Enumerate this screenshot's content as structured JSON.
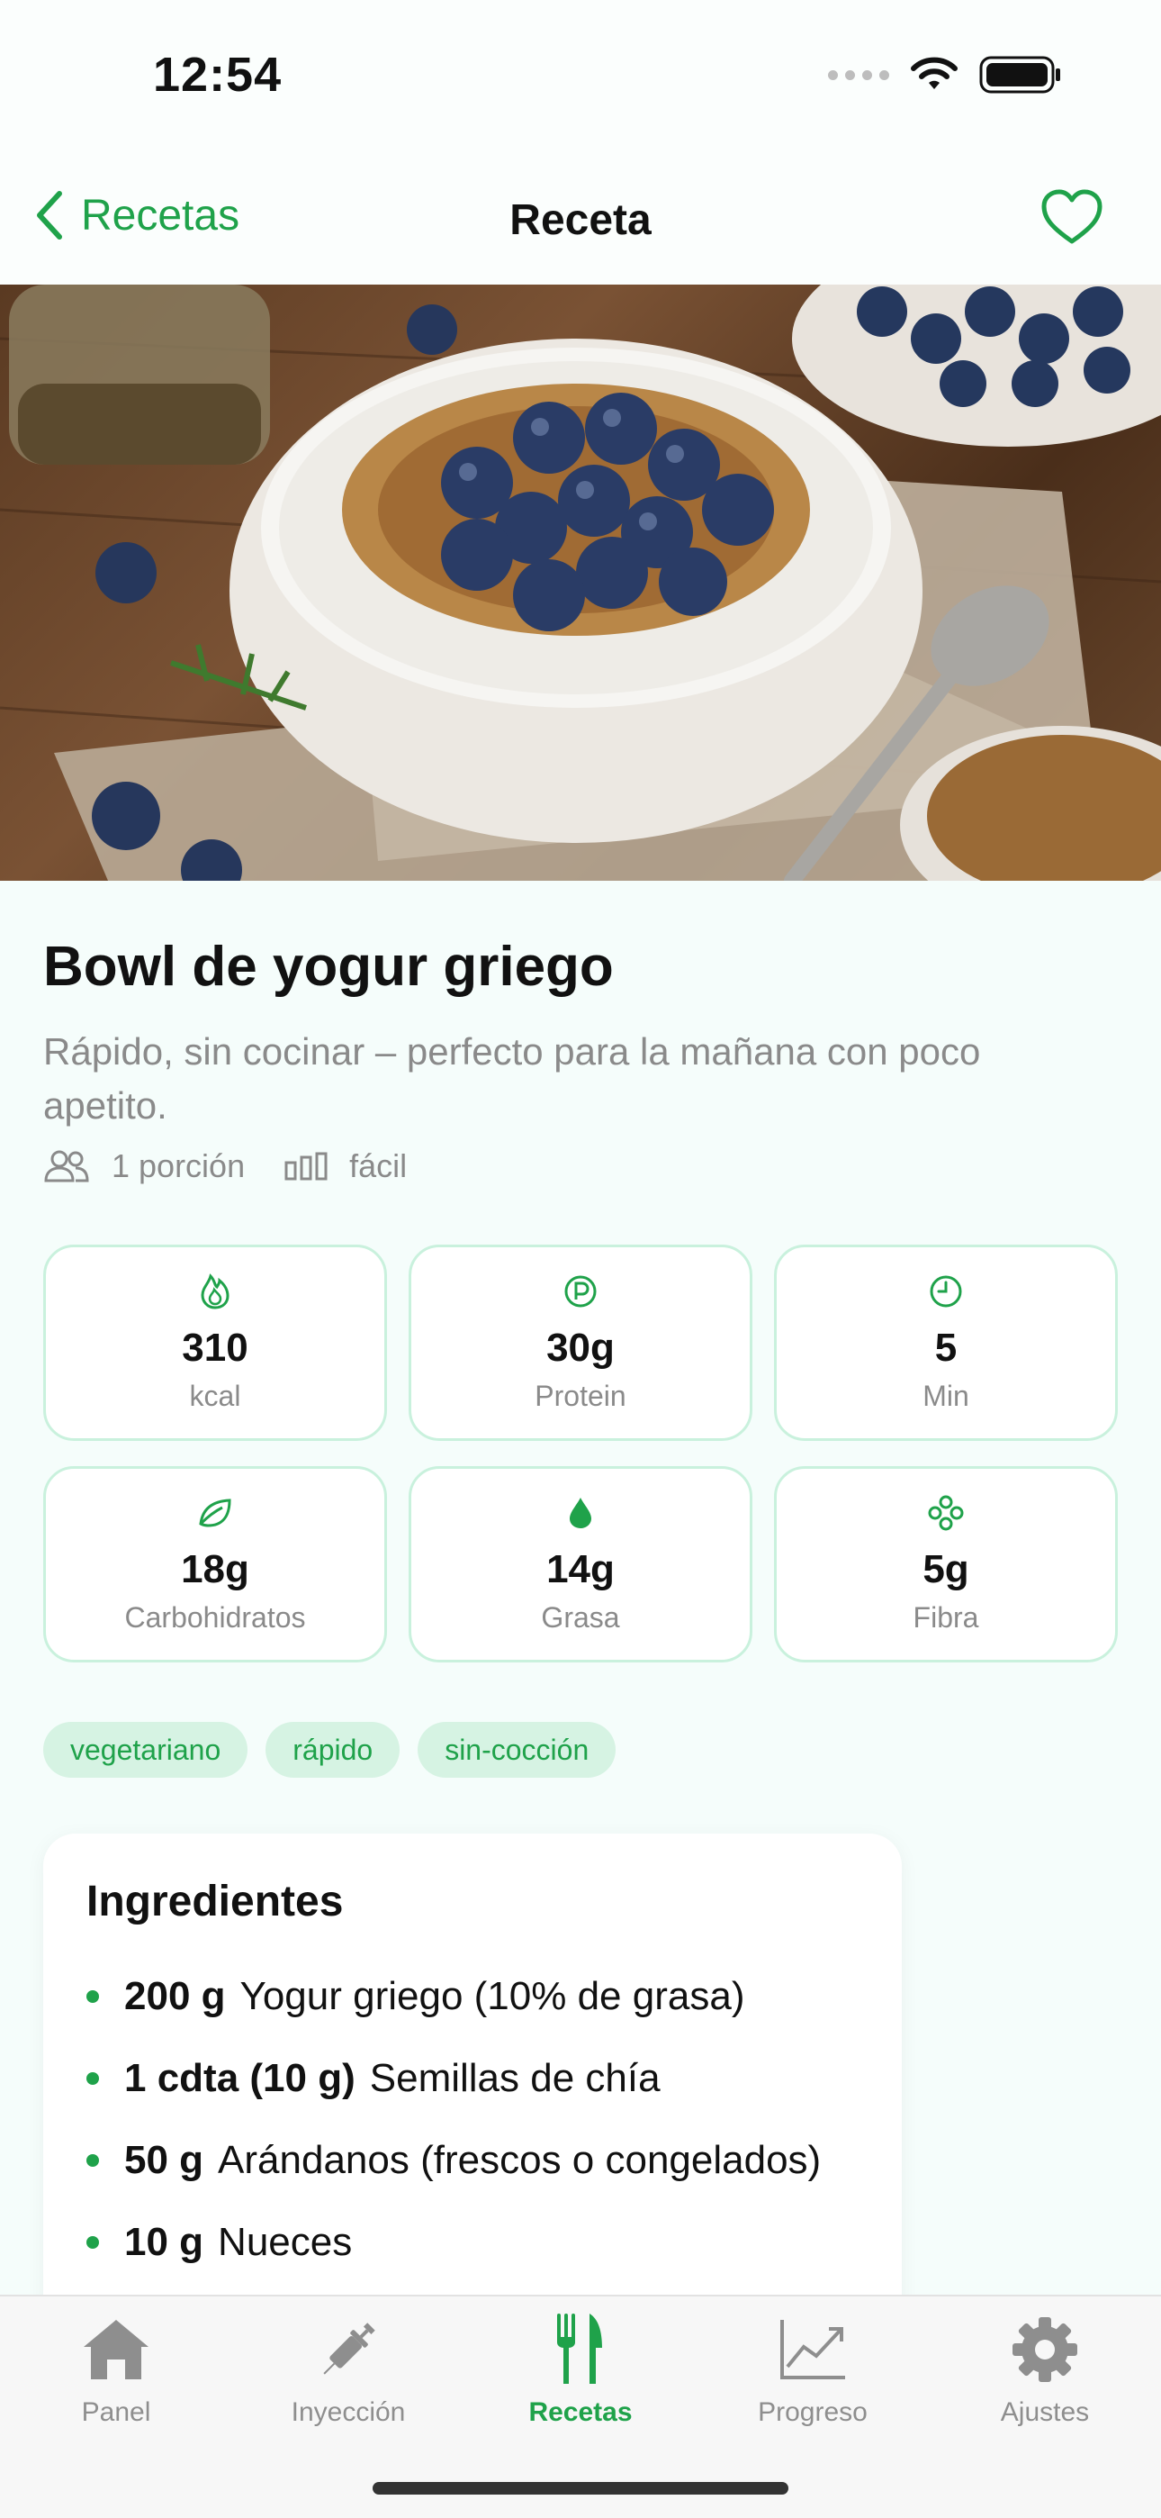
{
  "status_bar": {
    "time": "12:54"
  },
  "nav": {
    "back_label": "Recetas",
    "title": "Receta"
  },
  "recipe": {
    "title": "Bowl de yogur griego",
    "description": "Rápido, sin cocinar – perfecto para la mañana con poco apetito.",
    "servings": "1 porción",
    "difficulty": "fácil"
  },
  "stats": [
    {
      "icon": "flame-icon",
      "value": "310",
      "label": "kcal"
    },
    {
      "icon": "protein-icon",
      "value": "30g",
      "label": "Protein"
    },
    {
      "icon": "clock-icon",
      "value": "5",
      "label": "Min"
    },
    {
      "icon": "leaf-icon",
      "value": "18g",
      "label": "Carbohidratos"
    },
    {
      "icon": "drop-icon",
      "value": "14g",
      "label": "Grasa"
    },
    {
      "icon": "fiber-icon",
      "value": "5g",
      "label": "Fibra"
    }
  ],
  "tags": [
    "vegetariano",
    "rápido",
    "sin-cocción"
  ],
  "ingredients": {
    "title": "Ingredientes",
    "items": [
      {
        "qty": "200 g",
        "name": "Yogur griego (10% de grasa)"
      },
      {
        "qty": "1 cdta (10 g)",
        "name": "Semillas de chía"
      },
      {
        "qty": "50 g",
        "name": "Arándanos (frescos o congelados)"
      },
      {
        "qty": "10 g",
        "name": "Nueces"
      }
    ]
  },
  "tabs": [
    {
      "icon": "house-icon",
      "label": "Panel",
      "active": false
    },
    {
      "icon": "syringe-icon",
      "label": "Inyección",
      "active": false
    },
    {
      "icon": "fork-knife-icon",
      "label": "Recetas",
      "active": true
    },
    {
      "icon": "chart-icon",
      "label": "Progreso",
      "active": false
    },
    {
      "icon": "gear-icon",
      "label": "Ajustes",
      "active": false
    }
  ],
  "colors": {
    "accent": "#1fa24a",
    "tag_bg": "#d6f3e3",
    "card_border": "#c9f1dd",
    "muted": "#8a8a8a"
  }
}
